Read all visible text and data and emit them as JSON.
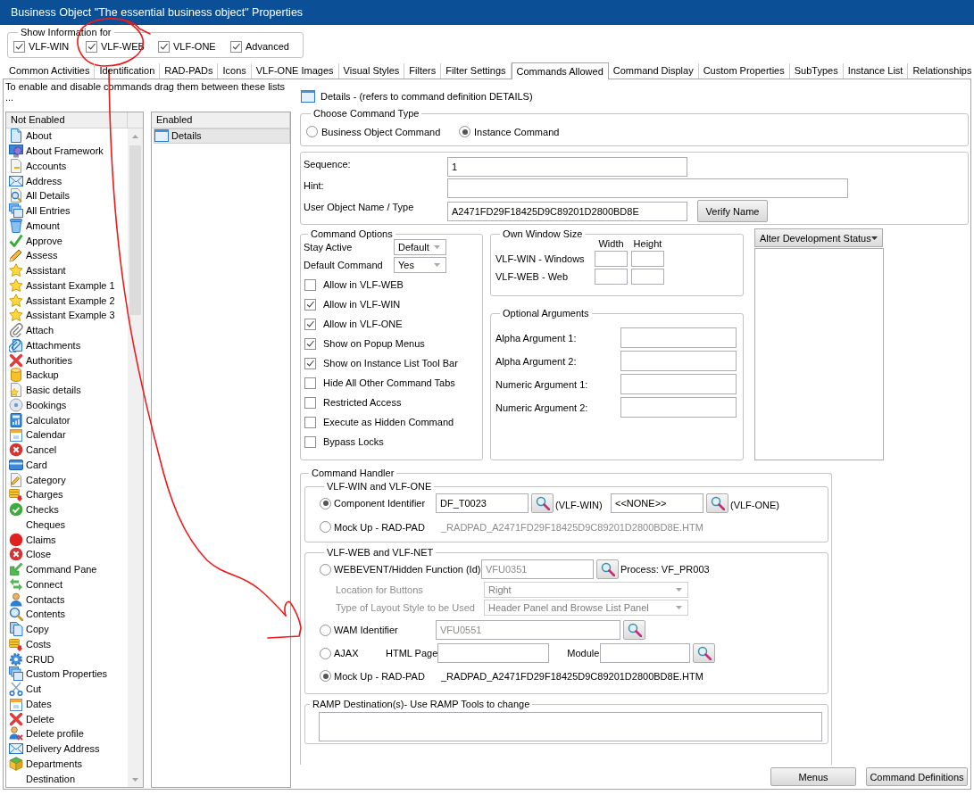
{
  "window": {
    "title": "Business Object \"The essential business object\" Properties"
  },
  "show_information": {
    "legend": "Show Information for",
    "options": [
      {
        "label": "VLF-WIN",
        "checked": true
      },
      {
        "label": "VLF-WEB",
        "checked": true
      },
      {
        "label": "VLF-ONE",
        "checked": true
      },
      {
        "label": "Advanced",
        "checked": true
      }
    ]
  },
  "tabs": [
    {
      "label": "Common Activities",
      "selected": false
    },
    {
      "label": "Identification",
      "selected": false
    },
    {
      "label": "RAD-PADs",
      "selected": false
    },
    {
      "label": "Icons",
      "selected": false
    },
    {
      "label": "VLF-ONE Images",
      "selected": false
    },
    {
      "label": "Visual Styles",
      "selected": false
    },
    {
      "label": "Filters",
      "selected": false
    },
    {
      "label": "Filter Settings",
      "selected": false
    },
    {
      "label": "Commands Allowed",
      "selected": true
    },
    {
      "label": "Command Display",
      "selected": false
    },
    {
      "label": "Custom Properties",
      "selected": false
    },
    {
      "label": "SubTypes",
      "selected": false
    },
    {
      "label": "Instance List",
      "selected": false
    },
    {
      "label": "Relationships",
      "selected": false
    }
  ],
  "instructions": {
    "text": "To enable and disable commands drag them between these lists",
    "more": "..."
  },
  "not_enabled_list": {
    "header": "Not Enabled",
    "items": [
      {
        "label": "About",
        "kind": "doc",
        "selected": false
      },
      {
        "label": "About Framework",
        "kind": "monitor-gear",
        "selected": false
      },
      {
        "label": "Accounts",
        "kind": "page",
        "selected": false
      },
      {
        "label": "Address",
        "kind": "envelope",
        "selected": false
      },
      {
        "label": "All Details",
        "kind": "search-doc",
        "selected": false
      },
      {
        "label": "All Entries",
        "kind": "windows",
        "selected": false
      },
      {
        "label": "Amount",
        "kind": "bin",
        "selected": false
      },
      {
        "label": "Approve",
        "kind": "check",
        "selected": false
      },
      {
        "label": "Assess",
        "kind": "pencil",
        "selected": false
      },
      {
        "label": "Assistant",
        "kind": "star",
        "selected": false
      },
      {
        "label": "Assistant Example 1",
        "kind": "star",
        "selected": false
      },
      {
        "label": "Assistant Example 2",
        "kind": "star",
        "selected": false
      },
      {
        "label": "Assistant Example 3",
        "kind": "star",
        "selected": false
      },
      {
        "label": "Attach",
        "kind": "clip",
        "selected": false
      },
      {
        "label": "Attachments",
        "kind": "clip-doc",
        "selected": false
      },
      {
        "label": "Authorities",
        "kind": "cross",
        "selected": false
      },
      {
        "label": "Backup",
        "kind": "database",
        "selected": false
      },
      {
        "label": "Basic details",
        "kind": "star-doc",
        "selected": false
      },
      {
        "label": "Bookings",
        "kind": "disc",
        "selected": false
      },
      {
        "label": "Calculator",
        "kind": "calculator",
        "selected": false
      },
      {
        "label": "Calendar",
        "kind": "calendar",
        "selected": false
      },
      {
        "label": "Cancel",
        "kind": "cancel",
        "selected": false
      },
      {
        "label": "Card",
        "kind": "card",
        "selected": false
      },
      {
        "label": "Category",
        "kind": "pencil-doc",
        "selected": false
      },
      {
        "label": "Charges",
        "kind": "coins",
        "selected": false
      },
      {
        "label": "Checks",
        "kind": "check-circle",
        "selected": false
      },
      {
        "label": "Cheques",
        "kind": "none",
        "selected": false
      },
      {
        "label": "Claims",
        "kind": "ball",
        "selected": false
      },
      {
        "label": "Close",
        "kind": "cancel",
        "selected": false
      },
      {
        "label": "Command Pane",
        "kind": "arrow",
        "selected": false
      },
      {
        "label": "Connect",
        "kind": "swap",
        "selected": false
      },
      {
        "label": "Contacts",
        "kind": "person",
        "selected": false
      },
      {
        "label": "Contents",
        "kind": "magnifier",
        "selected": false
      },
      {
        "label": "Copy",
        "kind": "copy",
        "selected": false
      },
      {
        "label": "Costs",
        "kind": "coins",
        "selected": false
      },
      {
        "label": "CRUD",
        "kind": "gear",
        "selected": false
      },
      {
        "label": "Custom Properties",
        "kind": "windows",
        "selected": false
      },
      {
        "label": "Cut",
        "kind": "scissors",
        "selected": false
      },
      {
        "label": "Dates",
        "kind": "calendar",
        "selected": false
      },
      {
        "label": "Delete",
        "kind": "cross",
        "selected": false
      },
      {
        "label": "Delete profile",
        "kind": "person-x",
        "selected": false
      },
      {
        "label": "Delivery Address",
        "kind": "envelope",
        "selected": false
      },
      {
        "label": "Departments",
        "kind": "cube",
        "selected": false
      },
      {
        "label": "Destination",
        "kind": "none",
        "selected": false
      }
    ]
  },
  "enabled_list": {
    "header": "Enabled",
    "items": [
      {
        "label": "Details",
        "kind": "window",
        "selected": true
      }
    ]
  },
  "details_heading": "Details - (refers to command definition DETAILS)",
  "command_type": {
    "legend": "Choose Command Type",
    "options": [
      {
        "label": "Business Object Command",
        "selected": false
      },
      {
        "label": "Instance Command",
        "selected": true
      }
    ]
  },
  "identity": {
    "sequence": {
      "label": "Sequence:",
      "value": "1"
    },
    "hint": {
      "label": "Hint:"
    },
    "user_object": {
      "label": "User Object Name / Type",
      "value": "A2471FD29F18425D9C89201D2800BD8E"
    },
    "verify_button": "Verify Name"
  },
  "command_options": {
    "legend": "Command Options",
    "stay_active": {
      "label": "Stay Active",
      "value": "Default"
    },
    "default_command": {
      "label": "Default Command",
      "value": "Yes"
    },
    "checkboxes": [
      {
        "label": "Allow in VLF-WEB",
        "checked": false
      },
      {
        "label": "Allow in VLF-WIN",
        "checked": true
      },
      {
        "label": "Allow in VLF-ONE",
        "checked": true
      },
      {
        "label": "Show on Popup Menus",
        "checked": true
      },
      {
        "label": "Show on Instance List Tool Bar",
        "checked": true
      },
      {
        "label": "Hide All Other Command Tabs",
        "checked": false
      },
      {
        "label": "Restricted Access",
        "checked": false
      },
      {
        "label": "Execute as Hidden Command",
        "checked": false
      },
      {
        "label": "Bypass Locks",
        "checked": false
      }
    ]
  },
  "own_window_size": {
    "legend": "Own Window Size",
    "columns": [
      "Width",
      "Height"
    ],
    "rows": [
      {
        "label": "VLF-WIN - Windows"
      },
      {
        "label": "VLF-WEB - Web"
      }
    ]
  },
  "optional_arguments": {
    "legend": "Optional Arguments",
    "rows": [
      {
        "label": "Alpha Argument 1:"
      },
      {
        "label": "Alpha Argument 2:"
      },
      {
        "label": "Numeric Argument 1:"
      },
      {
        "label": "Numeric Argument 2:"
      }
    ]
  },
  "alter_status": {
    "label": "Alter Development Status"
  },
  "command_handler": {
    "legend": "Command Handler",
    "win_one": {
      "legend": "VLF-WIN and VLF-ONE",
      "component": {
        "label": "Component Identifier",
        "selected": true,
        "win_value": "DF_T0023",
        "win_suffix": "(VLF-WIN)",
        "one_value": "<<NONE>>",
        "one_suffix": "(VLF-ONE)"
      },
      "mockup": {
        "label": "Mock Up - RAD-PAD",
        "selected": false,
        "file": "_RADPAD_A2471FD29F18425D9C89201D2800BD8E.HTM"
      }
    },
    "web_net": {
      "legend": "VLF-WEB and VLF-NET",
      "webevent": {
        "label": "WEBEVENT/Hidden Function (Id)",
        "selected": false,
        "value": "VFU0351",
        "process": "Process: VF_PR003"
      },
      "location": {
        "label": "Location for Buttons",
        "value": "Right",
        "disabled": true
      },
      "layout_style": {
        "label": "Type of Layout Style to be Used",
        "value": "Header Panel and Browse List Panel",
        "disabled": true
      },
      "wam": {
        "label": "WAM Identifier",
        "selected": false,
        "value": "VFU0551"
      },
      "ajax": {
        "label": "AJAX",
        "selected": false,
        "html_page": "HTML Page",
        "module": "Module"
      },
      "mockup": {
        "label": "Mock Up - RAD-PAD",
        "selected": true,
        "file": "_RADPAD_A2471FD29F18425D9C89201D2800BD8E.HTM"
      }
    },
    "ramp": {
      "legend": "RAMP Destination(s)- Use RAMP Tools to change"
    }
  },
  "buttons": [
    {
      "label": "Menus"
    },
    {
      "label": "Command Definitions"
    }
  ],
  "annotations": [
    {
      "kind": "circle"
    },
    {
      "kind": "arrow"
    }
  ]
}
